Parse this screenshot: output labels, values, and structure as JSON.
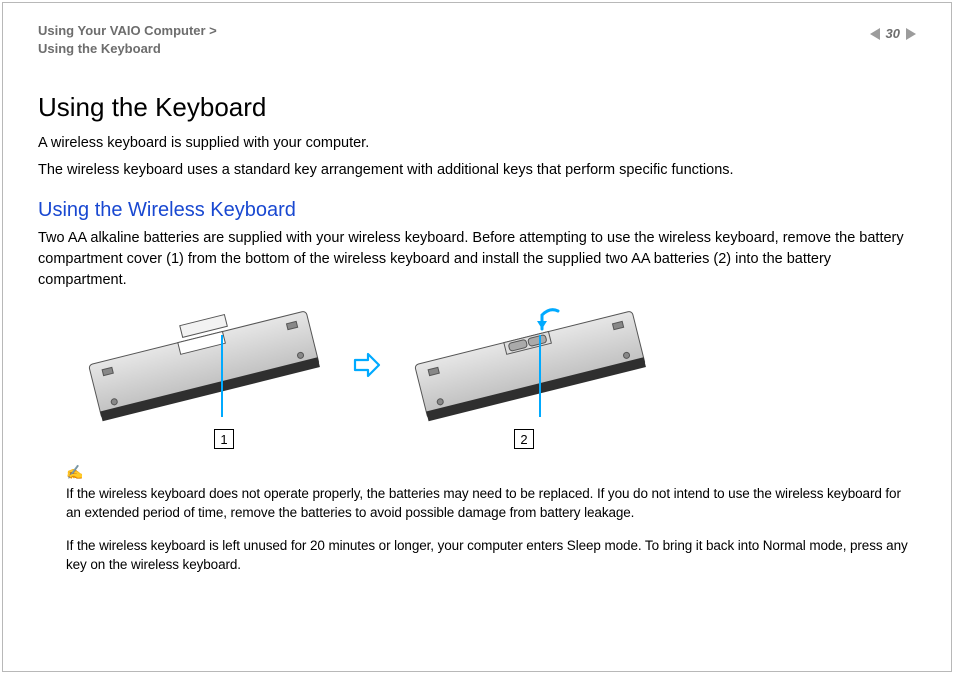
{
  "header": {
    "breadcrumb_line1": "Using Your VAIO Computer >",
    "breadcrumb_line2": "Using the Keyboard",
    "page_number": "30"
  },
  "content": {
    "title": "Using the Keyboard",
    "p1": "A wireless keyboard is supplied with your computer.",
    "p2": "The wireless keyboard uses a standard key arrangement with additional keys that perform specific functions.",
    "subhead": "Using the Wireless Keyboard",
    "p3": "Two AA alkaline batteries are supplied with your wireless keyboard. Before attempting to use the wireless keyboard, remove the battery compartment cover (1) from the bottom of the wireless keyboard and install the supplied two AA batteries (2) into the battery compartment."
  },
  "figure": {
    "callout1": "1",
    "callout2": "2"
  },
  "notes": {
    "icon_glyph": "✍",
    "n1": "If the wireless keyboard does not operate properly, the batteries may need to be replaced. If you do not intend to use the wireless keyboard for an extended period of time, remove the batteries to avoid possible damage from battery leakage.",
    "n2": "If the wireless keyboard is left unused for 20 minutes or longer, your computer enters Sleep mode. To bring it back into Normal mode, press any key on the wireless keyboard."
  }
}
